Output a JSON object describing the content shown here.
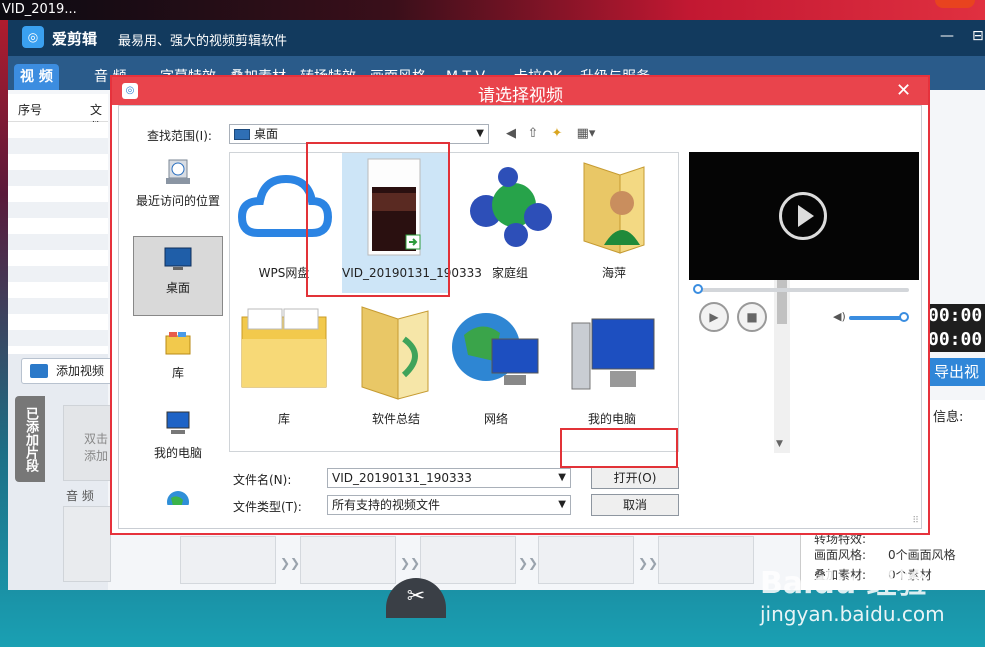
{
  "taskbar": {
    "title": "VID_2019..."
  },
  "app": {
    "name": "爱剪辑",
    "slogan": "最易用、强大的视频剪辑软件",
    "min_glyph": "—",
    "max_glyph": "⊟",
    "tabs": [
      "视 频",
      "音 频",
      "字幕特效",
      "叠加素材",
      "转场特效",
      "画面风格",
      "M T V",
      "卡拉OK",
      "升级与服务"
    ],
    "list_headers": {
      "index": "序号",
      "file": "文件"
    },
    "add_video_label": "添加视频",
    "side_tab_label": "已添加片段",
    "clip_hint": "双击添加",
    "audio_label": "音 频",
    "time_top": "00:00.",
    "time_bottom": "00:00.",
    "export_label": "导出视",
    "info_header": "信息:",
    "info_rows": [
      {
        "key": "转场特效:",
        "val": ""
      },
      {
        "key": "画面风格:",
        "val": "0个画面风格"
      },
      {
        "key": "叠加素材:",
        "val": "0个素材"
      }
    ],
    "scissors_glyph": "✂"
  },
  "dialog": {
    "title": "请选择视频",
    "close_glyph": "✕",
    "look_in_label": "查找范围(I):",
    "look_in_value": "桌面",
    "places": [
      "最近访问的位置",
      "桌面",
      "库",
      "我的电脑"
    ],
    "files": [
      {
        "label": "WPS网盘",
        "icon": "cloud-icon"
      },
      {
        "label": "VID_20190131_190333",
        "icon": "video-thumb-icon"
      },
      {
        "label": "家庭组",
        "icon": "homegroup-icon"
      },
      {
        "label": "海萍",
        "icon": "user-folder-icon"
      },
      {
        "label": "库",
        "icon": "library-folder-icon"
      },
      {
        "label": "软件总结",
        "icon": "folder-icon"
      },
      {
        "label": "网络",
        "icon": "network-icon"
      },
      {
        "label": "我的电脑",
        "icon": "computer-icon"
      }
    ],
    "filename_label": "文件名(N):",
    "filename_value": "VID_20190131_190333",
    "filetype_label": "文件类型(T):",
    "filetype_value": "所有支持的视频文件",
    "open_label": "打开(O)",
    "cancel_label": "取消"
  },
  "watermark": {
    "brand": "Baidu 经验",
    "url": "jingyan.baidu.com"
  },
  "colors": {
    "accent": "#e6323c",
    "app_header": "#123a5e",
    "tab_active": "#3c8de0"
  }
}
